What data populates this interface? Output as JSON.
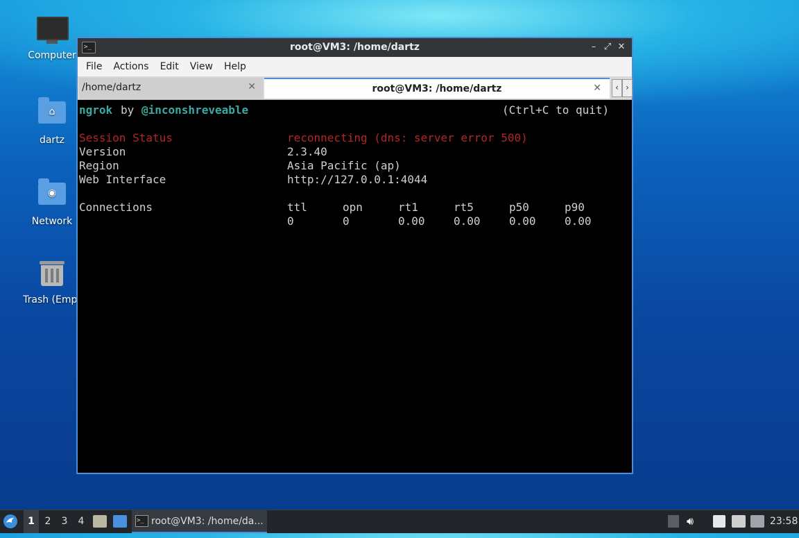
{
  "desktop": {
    "icons": [
      {
        "label": "Computer"
      },
      {
        "label": "dartz"
      },
      {
        "label": "Network"
      },
      {
        "label": "Trash (Empt"
      }
    ]
  },
  "window": {
    "title": "root@VM3: /home/dartz",
    "menu": [
      "File",
      "Actions",
      "Edit",
      "View",
      "Help"
    ],
    "tabs": [
      {
        "label": "/home/dartz",
        "active": false
      },
      {
        "label": "root@VM3: /home/dartz",
        "active": true
      }
    ]
  },
  "terminal": {
    "app": "ngrok",
    "by": "by",
    "author": "@inconshreveable",
    "quit_hint": "(Ctrl+C to quit)",
    "session_status_label": "Session Status",
    "session_status_value": "reconnecting (dns: server error 500)",
    "version_label": "Version",
    "version_value": "2.3.40",
    "region_label": "Region",
    "region_value": "Asia Pacific (ap)",
    "web_interface_label": "Web Interface",
    "web_interface_value": "http://127.0.0.1:4044",
    "connections_label": "Connections",
    "metrics": [
      {
        "name": "ttl",
        "value": "0"
      },
      {
        "name": "opn",
        "value": "0"
      },
      {
        "name": "rt1",
        "value": "0.00"
      },
      {
        "name": "rt5",
        "value": "0.00"
      },
      {
        "name": "p50",
        "value": "0.00"
      },
      {
        "name": "p90",
        "value": "0.00"
      }
    ]
  },
  "taskbar": {
    "workspaces": [
      "1",
      "2",
      "3",
      "4"
    ],
    "active_task": "root@VM3: /home/da...",
    "clock": "23:58"
  },
  "colors": {
    "accent": "#4a90d9",
    "status_red": "#b52626",
    "teal": "#3aa9a3"
  }
}
